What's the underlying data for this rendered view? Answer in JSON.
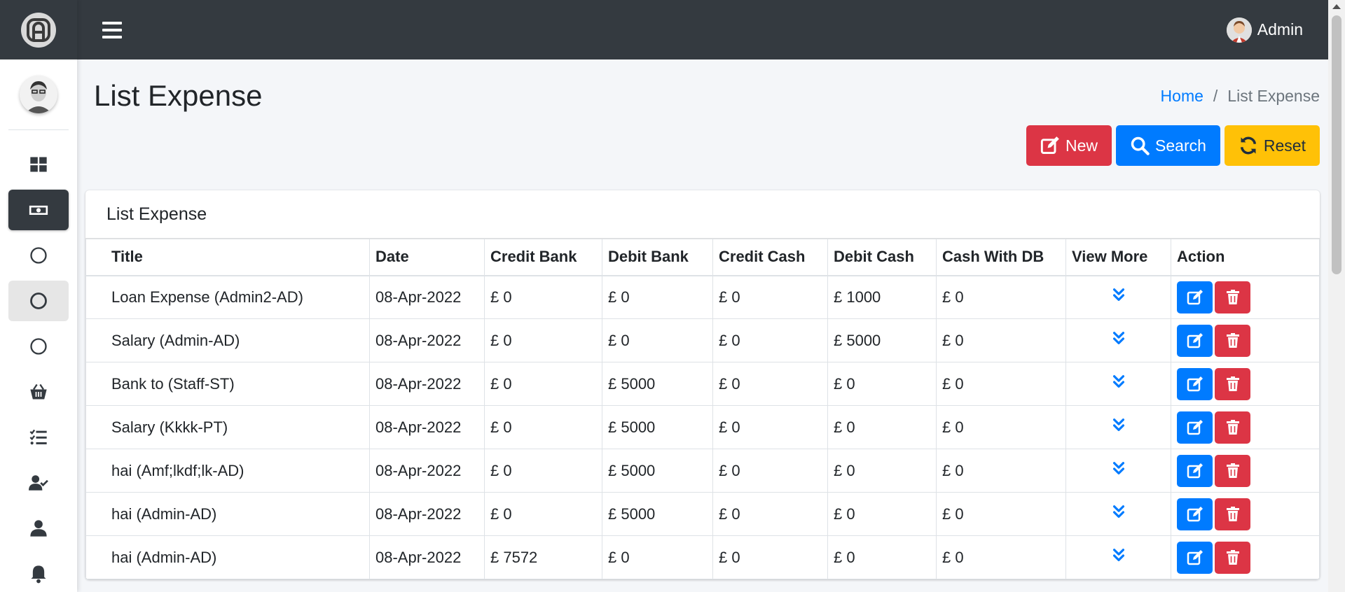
{
  "topbar": {
    "user_name": "Admin"
  },
  "page": {
    "title": "List Expense",
    "breadcrumb": {
      "home": "Home",
      "separator": "/",
      "current": "List Expense"
    }
  },
  "actions": {
    "new_label": "New",
    "search_label": "Search",
    "reset_label": "Reset"
  },
  "card": {
    "title": "List Expense"
  },
  "table": {
    "headers": [
      "Title",
      "Date",
      "Credit Bank",
      "Debit Bank",
      "Credit Cash",
      "Debit Cash",
      "Cash With DB",
      "View More",
      "Action"
    ],
    "rows": [
      [
        "Loan Expense (Admin2-AD)",
        "08-Apr-2022",
        "£ 0",
        "£ 0",
        "£ 0",
        "£ 1000",
        "£ 0"
      ],
      [
        "Salary (Admin-AD)",
        "08-Apr-2022",
        "£ 0",
        "£ 0",
        "£ 0",
        "£ 5000",
        "£ 0"
      ],
      [
        "Bank to (Staff-ST)",
        "08-Apr-2022",
        "£ 0",
        "£ 5000",
        "£ 0",
        "£ 0",
        "£ 0"
      ],
      [
        "Salary (Kkkk-PT)",
        "08-Apr-2022",
        "£ 0",
        "£ 5000",
        "£ 0",
        "£ 0",
        "£ 0"
      ],
      [
        "hai (Amf;lkdf;lk-AD)",
        "08-Apr-2022",
        "£ 0",
        "£ 5000",
        "£ 0",
        "£ 0",
        "£ 0"
      ],
      [
        "hai (Admin-AD)",
        "08-Apr-2022",
        "£ 0",
        "£ 5000",
        "£ 0",
        "£ 0",
        "£ 0"
      ],
      [
        "hai (Admin-AD)",
        "08-Apr-2022",
        "£ 7572",
        "£ 0",
        "£ 0",
        "£ 0",
        "£ 0"
      ]
    ]
  },
  "sidebar": {
    "items": [
      {
        "icon": "dashboard-icon",
        "state": "normal"
      },
      {
        "icon": "money-bill-icon",
        "state": "active"
      },
      {
        "icon": "circle-icon",
        "state": "normal"
      },
      {
        "icon": "circle-icon",
        "state": "hover"
      },
      {
        "icon": "circle-icon",
        "state": "normal"
      },
      {
        "icon": "basket-icon",
        "state": "normal"
      },
      {
        "icon": "tasks-icon",
        "state": "normal"
      },
      {
        "icon": "user-check-icon",
        "state": "normal"
      },
      {
        "icon": "user-icon",
        "state": "normal"
      },
      {
        "icon": "bell-icon",
        "state": "normal"
      }
    ]
  },
  "colors": {
    "primary": "#007bff",
    "danger": "#dc3545",
    "warning": "#ffc107",
    "dark": "#343a40"
  }
}
